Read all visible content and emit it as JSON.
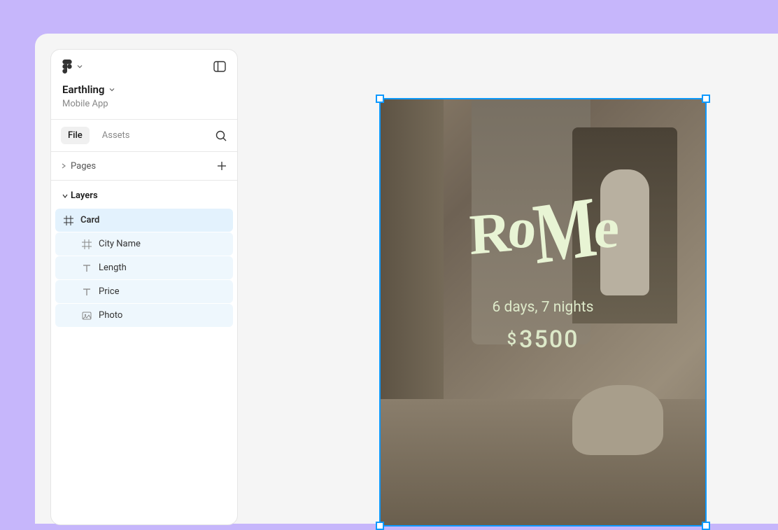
{
  "project": {
    "name": "Earthling",
    "subtitle": "Mobile App"
  },
  "tabs": {
    "file": "File",
    "assets": "Assets"
  },
  "pages_label": "Pages",
  "layers_label": "Layers",
  "layers": {
    "card": "Card",
    "city_name": "City Name",
    "length": "Length",
    "price": "Price",
    "photo": "Photo"
  },
  "card": {
    "city": "Rome",
    "length": "6 days, 7 nights",
    "price_currency": "$",
    "price_value": "3500"
  }
}
